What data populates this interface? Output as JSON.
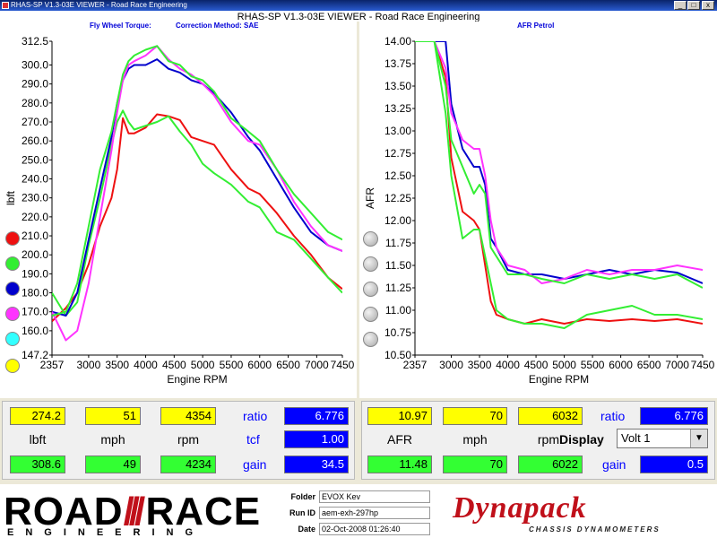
{
  "window": {
    "title": "RHAS-SP V1.3-03E VIEWER - Road Race Engineering",
    "app_title": "RHAS-SP V1.3-03E VIEWER - Road Race Engineering",
    "minimize": "_",
    "maximize": "□",
    "close": "x"
  },
  "left_chart": {
    "header": "Fly Wheel Torque:",
    "correction": "Correction Method: SAE",
    "ylabel": "lbft",
    "xlabel": "Engine RPM"
  },
  "right_chart": {
    "header": "AFR Petrol",
    "ylabel": "AFR",
    "xlabel": "Engine RPM"
  },
  "legend_colors": [
    "#ee1111",
    "#33ee33",
    "#0000cc",
    "#ff33ff",
    "#33ffff",
    "#ffff00"
  ],
  "chart_data": [
    {
      "type": "line",
      "title": "Fly Wheel Torque:",
      "subtitle": "Correction Method: SAE",
      "xlabel": "Engine RPM",
      "ylabel": "lbft",
      "xlim": [
        2357,
        7450
      ],
      "ylim": [
        147.2,
        312.5
      ],
      "x_ticks": [
        "2357",
        "3000",
        "3500",
        "4000",
        "4500",
        "5000",
        "5500",
        "6000",
        "6500",
        "7000",
        "7450"
      ],
      "y_ticks": [
        "312.5",
        "300.0",
        "290.0",
        "280.0",
        "270.0",
        "260.0",
        "250.0",
        "240.0",
        "230.0",
        "220.0",
        "210.0",
        "200.0",
        "190.0",
        "180.0",
        "170.0",
        "160.0",
        "147.2"
      ],
      "grid": false,
      "x": [
        2357,
        2600,
        2800,
        3000,
        3200,
        3400,
        3500,
        3600,
        3700,
        3800,
        4000,
        4200,
        4400,
        4600,
        4800,
        5000,
        5200,
        5500,
        5800,
        6000,
        6300,
        6600,
        6900,
        7200,
        7450
      ],
      "series": [
        {
          "color": "#ee1111",
          "values": [
            165,
            172,
            180,
            195,
            215,
            230,
            245,
            272,
            264,
            264,
            267,
            274,
            273,
            271,
            262,
            260,
            258,
            245,
            235,
            232,
            222,
            210,
            200,
            188,
            182
          ]
        },
        {
          "color": "#33ee33",
          "values": [
            180,
            168,
            175,
            205,
            230,
            258,
            270,
            276,
            270,
            266,
            268,
            270,
            273,
            265,
            258,
            248,
            243,
            237,
            228,
            225,
            212,
            208,
            198,
            188,
            180
          ]
        },
        {
          "color": "#0000cc",
          "values": [
            170,
            168,
            180,
            208,
            235,
            262,
            280,
            292,
            298,
            300,
            300,
            303,
            298,
            296,
            292,
            290,
            285,
            275,
            262,
            255,
            240,
            225,
            212,
            205,
            202
          ]
        },
        {
          "color": "#ff33ff",
          "values": [
            170,
            155,
            160,
            185,
            220,
            255,
            275,
            292,
            300,
            302,
            305,
            310,
            303,
            298,
            295,
            290,
            284,
            270,
            260,
            258,
            245,
            228,
            215,
            205,
            202
          ]
        },
        {
          "color": "#33ee33",
          "values": [
            168,
            170,
            185,
            215,
            245,
            265,
            280,
            295,
            302,
            305,
            308,
            310,
            302,
            300,
            294,
            292,
            286,
            272,
            265,
            260,
            245,
            232,
            222,
            212,
            208
          ]
        }
      ]
    },
    {
      "type": "line",
      "title": "AFR Petrol",
      "xlabel": "Engine RPM",
      "ylabel": "AFR",
      "xlim": [
        2357,
        7450
      ],
      "ylim": [
        10.5,
        14.0
      ],
      "x_ticks": [
        "2357",
        "3000",
        "3500",
        "4000",
        "4500",
        "5000",
        "5500",
        "6000",
        "6500",
        "7000",
        "7450"
      ],
      "y_ticks": [
        "14.00",
        "13.75",
        "13.50",
        "13.25",
        "13.00",
        "12.75",
        "12.50",
        "12.25",
        "12.00",
        "11.75",
        "11.50",
        "11.25",
        "11.00",
        "10.75",
        "10.50"
      ],
      "grid": false,
      "x": [
        2357,
        2700,
        2900,
        3000,
        3200,
        3400,
        3500,
        3600,
        3700,
        3800,
        4000,
        4300,
        4600,
        5000,
        5400,
        5800,
        6200,
        6600,
        7000,
        7450
      ],
      "series": [
        {
          "color": "#ee1111",
          "values": [
            14.0,
            14.0,
            13.6,
            12.7,
            12.1,
            12.0,
            11.9,
            11.5,
            11.1,
            10.95,
            10.9,
            10.85,
            10.9,
            10.85,
            10.9,
            10.88,
            10.9,
            10.88,
            10.9,
            10.85
          ]
        },
        {
          "color": "#33ee33",
          "values": [
            14.0,
            14.0,
            13.2,
            12.5,
            11.8,
            11.9,
            11.9,
            11.6,
            11.3,
            11.0,
            10.9,
            10.85,
            10.85,
            10.8,
            10.95,
            11.0,
            11.05,
            10.95,
            10.95,
            10.9
          ]
        },
        {
          "color": "#0000cc",
          "values": [
            14.0,
            14.0,
            14.0,
            13.3,
            12.8,
            12.6,
            12.6,
            12.4,
            11.8,
            11.7,
            11.45,
            11.4,
            11.4,
            11.35,
            11.4,
            11.45,
            11.4,
            11.45,
            11.42,
            11.3
          ]
        },
        {
          "color": "#ff33ff",
          "values": [
            14.0,
            14.0,
            13.7,
            13.2,
            12.9,
            12.8,
            12.8,
            12.5,
            12.0,
            11.7,
            11.5,
            11.45,
            11.3,
            11.35,
            11.45,
            11.4,
            11.45,
            11.45,
            11.5,
            11.45
          ]
        },
        {
          "color": "#33ee33",
          "values": [
            14.0,
            14.0,
            13.5,
            12.9,
            12.6,
            12.3,
            12.4,
            12.3,
            11.7,
            11.6,
            11.4,
            11.4,
            11.35,
            11.3,
            11.4,
            11.35,
            11.4,
            11.35,
            11.4,
            11.25
          ]
        }
      ]
    }
  ],
  "left_readout": {
    "top": [
      "274.2",
      "51",
      "4354"
    ],
    "labels": [
      "lbft",
      "mph",
      "rpm"
    ],
    "bottom": [
      "308.6",
      "49",
      "4234"
    ],
    "ratio_label": "ratio",
    "ratio_value": "6.776",
    "tcf_label": "tcf",
    "tcf_value": "1.00",
    "gain_label": "gain",
    "gain_value": "34.5"
  },
  "right_readout": {
    "top": [
      "10.97",
      "70",
      "6032"
    ],
    "labels": [
      "AFR",
      "mph",
      "rpm"
    ],
    "bottom": [
      "11.48",
      "70",
      "6022"
    ],
    "ratio_label": "ratio",
    "ratio_value": "6.776",
    "display_label": "Display",
    "display_value": "Volt 1",
    "gain_label": "gain",
    "gain_value": "0.5"
  },
  "footer": {
    "logo_road": "ROAD",
    "logo_race": "RACE",
    "logo_sub": "ENGINEERING",
    "folder_label": "Folder",
    "folder_value": "EVOX Kev",
    "runid_label": "Run ID",
    "runid_value": "aem-exh-297hp",
    "date_label": "Date",
    "date_value": "02-Oct-2008  01:26:40",
    "brand": "Dynapack",
    "brand_sub": "CHASSIS DYNAMOMETERS"
  }
}
